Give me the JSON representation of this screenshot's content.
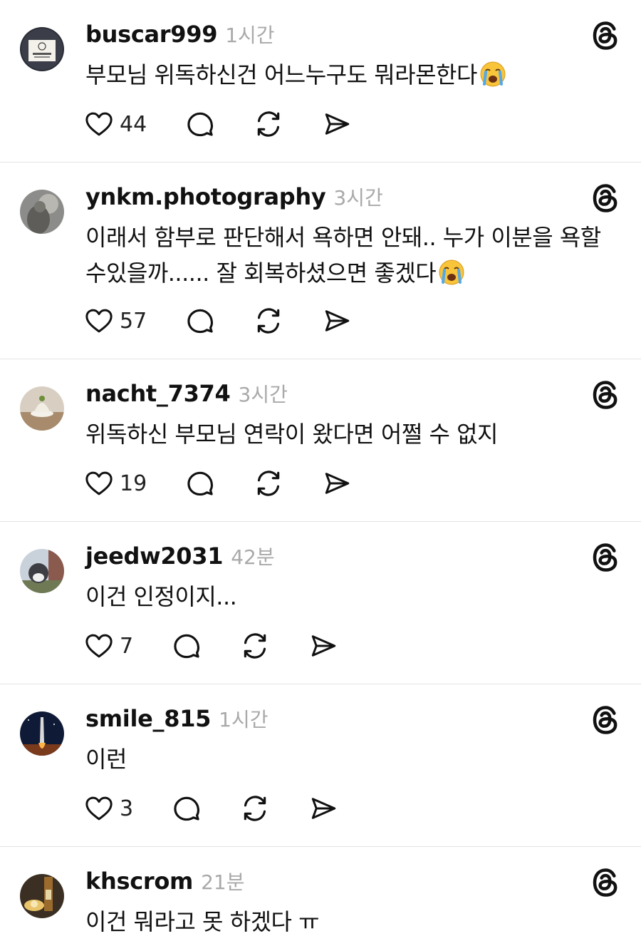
{
  "comments": [
    {
      "username": "buscar999",
      "time": "1시간",
      "text": "부모님 위독하신건 어느누구도 뭐라몬한다",
      "emoji": "loudly-crying-face",
      "likes": "44"
    },
    {
      "username": "ynkm.photography",
      "time": "3시간",
      "text": "이래서 함부로 판단해서 욕하면 안돼.. 누가 이분을 욕할 수있을까...... 잘 회복하셨으면 좋겠다",
      "emoji": "loudly-crying-face",
      "likes": "57"
    },
    {
      "username": "nacht_7374",
      "time": "3시간",
      "text": "위독하신 부모님 연락이 왔다면 어쩔 수 없지",
      "likes": "19"
    },
    {
      "username": "jeedw2031",
      "time": "42분",
      "text": "이건 인정이지...",
      "likes": "7"
    },
    {
      "username": "smile_815",
      "time": "1시간",
      "text": "이런",
      "likes": "3"
    },
    {
      "username": "khscrom",
      "time": "21분",
      "text": "이건 뭐라고 못 하겠다 ㅠ"
    }
  ],
  "colors": {
    "text": "#111111",
    "muted": "#a9a9a9",
    "divider": "#e2e2e2"
  },
  "icons": {
    "like": "heart-icon",
    "reply": "comment-bubble-icon",
    "repost": "repost-icon",
    "share": "send-icon",
    "brand": "threads-logo-icon"
  }
}
